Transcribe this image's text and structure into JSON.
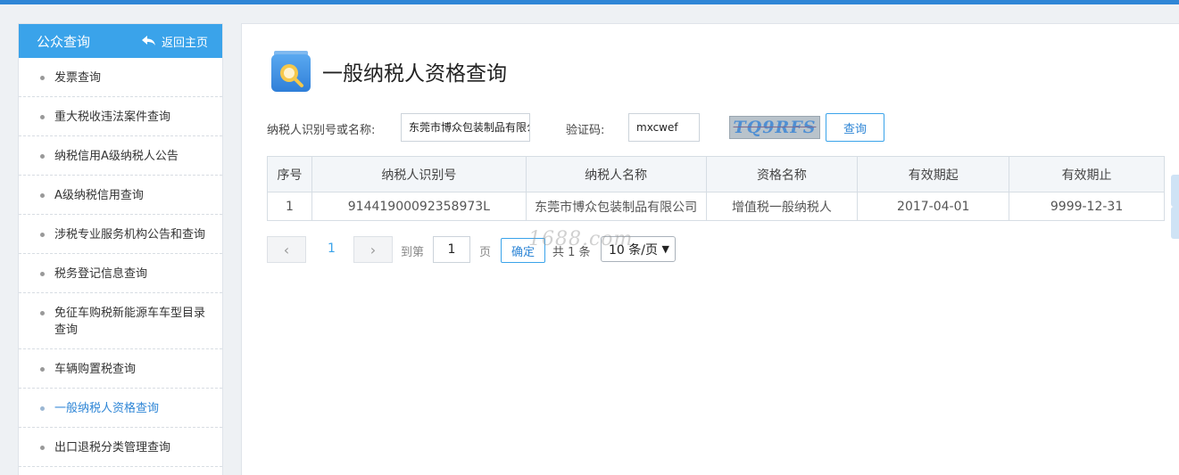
{
  "sidebar": {
    "title": "公众查询",
    "back_label": "返回主页",
    "items": [
      {
        "label": "发票查询"
      },
      {
        "label": "重大税收违法案件查询"
      },
      {
        "label": "纳税信用A级纳税人公告"
      },
      {
        "label": "A级纳税信用查询"
      },
      {
        "label": "涉税专业服务机构公告和查询"
      },
      {
        "label": "税务登记信息查询"
      },
      {
        "label": "免征车购税新能源车车型目录查询"
      },
      {
        "label": "车辆购置税查询"
      },
      {
        "label": "一般纳税人资格查询"
      },
      {
        "label": "出口退税分类管理查询"
      }
    ]
  },
  "page": {
    "title": "一般纳税人资格查询"
  },
  "search": {
    "taxpayer_label": "纳税人识别号或名称:",
    "taxpayer_value": "东莞市博众包装制品有限公司",
    "captcha_label": "验证码:",
    "captcha_value": "mxcwef",
    "captcha_image_text": "TQ9RFS",
    "query_label": "查询"
  },
  "table": {
    "headers": [
      "序号",
      "纳税人识别号",
      "纳税人名称",
      "资格名称",
      "有效期起",
      "有效期止"
    ],
    "rows": [
      [
        "1",
        "91441900092358973L",
        "东莞市博众包装制品有限公司",
        "增值税一般纳税人",
        "2017-04-01",
        "9999-12-31"
      ]
    ]
  },
  "pagination": {
    "current_page": "1",
    "goto_label": "到第",
    "goto_value": "1",
    "page_unit": "页",
    "confirm_label": "确定",
    "total_text": "共 1 条",
    "page_size": "10 条/页"
  },
  "watermark": "1688.com",
  "colors": {
    "accent": "#3aa3ea",
    "topbar": "#2f86d6",
    "active_link": "#2f86d6"
  }
}
